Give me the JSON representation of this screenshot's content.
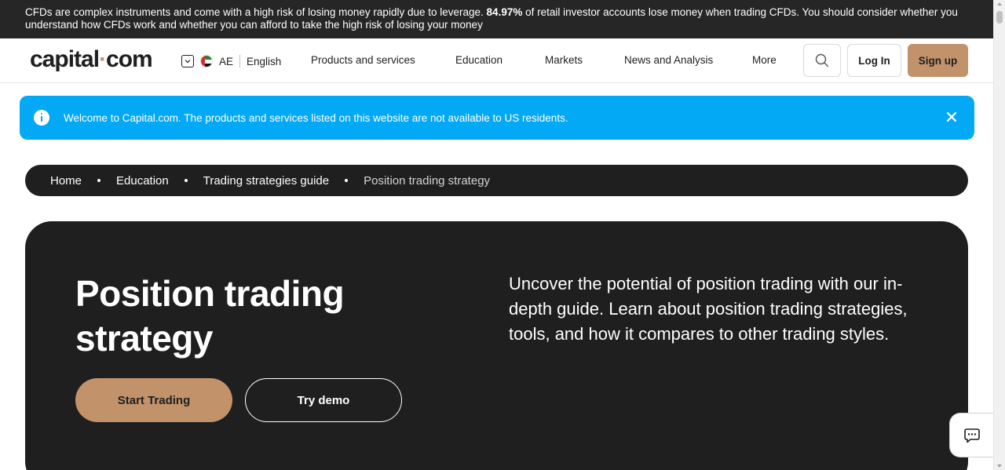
{
  "risk_warning": {
    "prefix": "CFDs are complex instruments and come with a high risk of losing money rapidly due to leverage.",
    "percent": "84.97%",
    "suffix": "of retail investor accounts lose money when trading CFDs. You should consider whether you understand how CFDs work and whether you can afford to take the high risk of losing your money"
  },
  "header": {
    "logo_left": "capital",
    "logo_dot": "·",
    "logo_right": "com",
    "region_code": "AE",
    "language": "English",
    "nav": [
      "Products and services",
      "Education",
      "Markets",
      "News and Analysis",
      "More"
    ],
    "login_label": "Log In",
    "signup_label": "Sign up"
  },
  "notice": {
    "text": "Welcome to Capital.com. The products and services listed on this website are not available to US residents."
  },
  "breadcrumb": {
    "items": [
      "Home",
      "Education",
      "Trading strategies guide"
    ],
    "current": "Position trading strategy"
  },
  "hero": {
    "title": "Position trading strategy",
    "description": "Uncover the potential of position trading with our in-depth guide. Learn about position trading strategies, tools, and how it compares to other trading styles.",
    "start_label": "Start Trading",
    "demo_label": "Try demo"
  },
  "colors": {
    "accent": "#c2926a",
    "dark": "#1f1f1f",
    "notice_blue": "#03a9f4"
  },
  "icons": [
    "chevron-down-icon",
    "uae-flag-icon",
    "search-icon",
    "info-icon",
    "close-icon",
    "chat-icon"
  ]
}
